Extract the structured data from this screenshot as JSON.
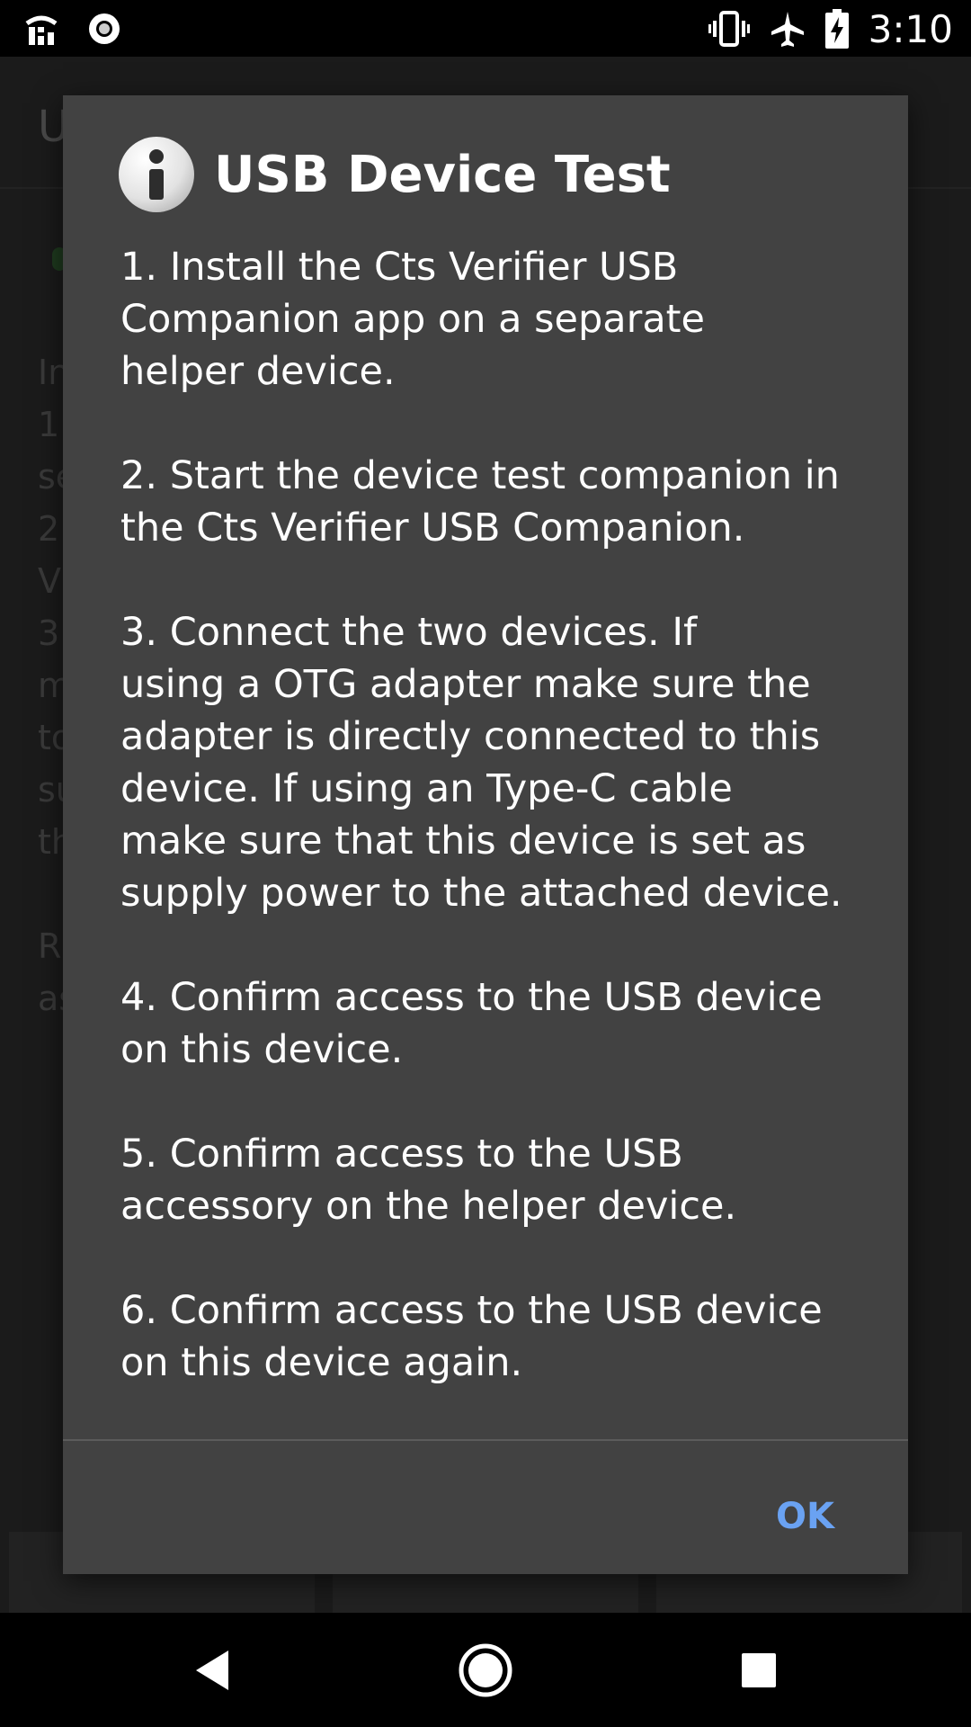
{
  "status_bar": {
    "time": "3:10",
    "icons": [
      "wifi-icon",
      "record-icon",
      "vibrate-icon",
      "airplane-mode-icon",
      "battery-charging-icon"
    ]
  },
  "background": {
    "title_fragment": "U",
    "line_fragments": [
      "In",
      "1",
      "se",
      "2",
      "V",
      "3",
      "m",
      "to",
      "su",
      "th",
      "",
      "R",
      "as"
    ]
  },
  "dialog": {
    "icon": "info-icon",
    "title": "USB Device Test",
    "body": "1. Install the Cts Verifier USB\nCompanion app on a separate\nhelper device.\n\n2. Start the device test companion in\nthe Cts Verifier USB Companion.\n\n3. Connect the two devices. If\nusing a OTG adapter make sure the\nadapter is directly connected to this\ndevice. If using an Type-C cable\nmake sure that this device is set as\nsupply power to the attached device.\n\n4. Confirm access to the USB device\non this device.\n\n5. Confirm access to the USB\naccessory on the helper device.\n\n6. Confirm access to the USB device\non this device again.",
    "ok_label": "OK",
    "accent_color": "#6aa2f2"
  },
  "nav_bar": {
    "buttons": [
      "back-icon",
      "home-icon",
      "recents-icon"
    ]
  }
}
